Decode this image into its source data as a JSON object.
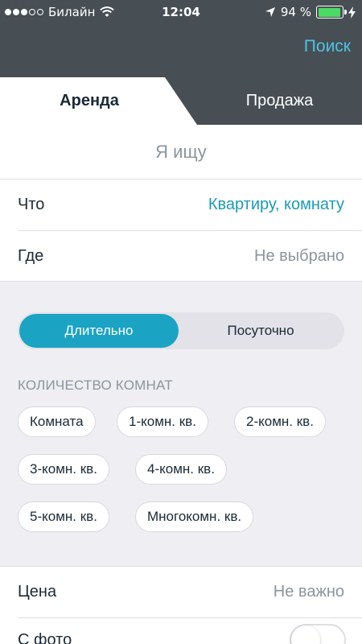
{
  "status_bar": {
    "carrier": "Билайн",
    "time": "12:04",
    "battery": "94 %",
    "battery_level": 0.94
  },
  "header": {
    "search_label": "Поиск",
    "tabs": [
      {
        "label": "Аренда",
        "active": true
      },
      {
        "label": "Продажа",
        "active": false
      }
    ]
  },
  "subtitle": "Я ищу",
  "what": {
    "label": "Что",
    "value": "Квартиру, комнату"
  },
  "where": {
    "label": "Где",
    "value": "Не выбрано"
  },
  "term": {
    "options": [
      "Длительно",
      "Посуточно"
    ],
    "selected": "Длительно"
  },
  "rooms": {
    "title": "КОЛИЧЕСТВО КОМНАТ",
    "options": [
      "Комната",
      "1-комн. кв.",
      "2-комн. кв.",
      "3-комн. кв.",
      "4-комн. кв.",
      "5-комн. кв.",
      "Многокомн. кв."
    ]
  },
  "price": {
    "label": "Цена",
    "value": "Не важно"
  },
  "with_photo": {
    "label": "С фото",
    "enabled": false
  },
  "colors": {
    "header_bg": "#474f55",
    "accent": "#1ba3c4",
    "link": "#4fc3e0",
    "filters_bg": "#eeeef3"
  }
}
